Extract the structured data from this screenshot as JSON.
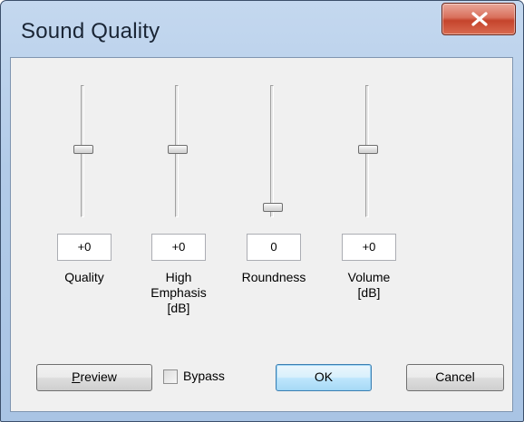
{
  "window": {
    "title": "Sound Quality"
  },
  "sliders": [
    {
      "label": "Quality",
      "value": "+0",
      "level": 0.5
    },
    {
      "label": "High\nEmphasis\n[dB]",
      "value": "+0",
      "level": 0.5
    },
    {
      "label": "Roundness",
      "value": "0",
      "level": 0.0
    },
    {
      "label": "Volume\n[dB]",
      "value": "+0",
      "level": 0.5
    }
  ],
  "buttons": {
    "preview_mnemonic": "P",
    "preview_rest": "review",
    "bypass_label": "Bypass",
    "bypass_checked": false,
    "ok_label": "OK",
    "cancel_label": "Cancel"
  },
  "icons": {
    "close": "close-icon"
  },
  "colors": {
    "close_button": "#c5442c",
    "title_bar": "#b2cbe8",
    "dialog_background": "#f0f0f0",
    "default_button": "#bee6fd"
  }
}
